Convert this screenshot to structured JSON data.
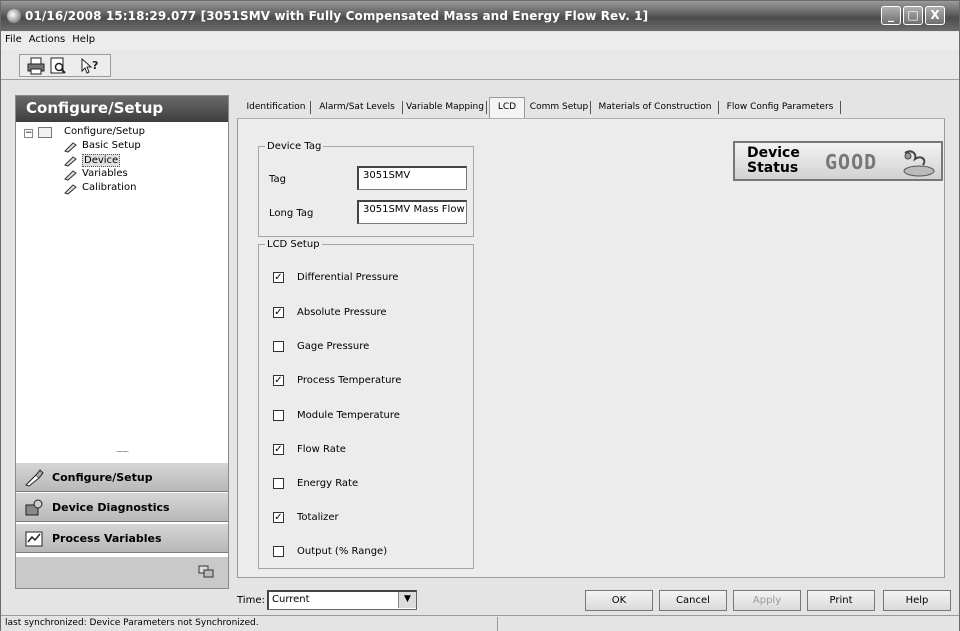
{
  "window": {
    "title": "01/16/2008 15:18:29.077 [3051SMV with Fully Compensated Mass and Energy Flow Rev. 1]",
    "minimize": "_",
    "maximize": "□",
    "close": "X"
  },
  "menu": [
    "File",
    "Actions",
    "Help"
  ],
  "toolbar": {
    "buttons": [
      "print-icon",
      "print-preview-icon",
      "help-pointer-icon"
    ]
  },
  "sidebar": {
    "header": "Configure/Setup",
    "tree": {
      "root": "Configure/Setup",
      "children": [
        "Basic Setup",
        "Device",
        "Variables",
        "Calibration"
      ],
      "selected": "Device"
    },
    "grip": "..........",
    "nav": [
      "Configure/Setup",
      "Device Diagnostics",
      "Process Variables"
    ]
  },
  "tabs": [
    "Identification",
    "Alarm/Sat Levels",
    "Variable Mapping",
    "LCD",
    "Comm Setup",
    "Materials of Construction",
    "Flow Config Parameters"
  ],
  "active_tab": "LCD",
  "device_tag": {
    "legend": "Device Tag",
    "tag_label": "Tag",
    "tag_value": "3051SMV",
    "long_tag_label": "Long Tag",
    "long_tag_value": "3051SMV Mass Flow"
  },
  "lcd_setup": {
    "legend": "LCD Setup",
    "items": [
      {
        "label": "Differential Pressure",
        "checked": true
      },
      {
        "label": "Absolute Pressure",
        "checked": true
      },
      {
        "label": "Gage Pressure",
        "checked": false
      },
      {
        "label": "Process Temperature",
        "checked": true
      },
      {
        "label": "Module Temperature",
        "checked": false
      },
      {
        "label": "Flow Rate",
        "checked": true
      },
      {
        "label": "Energy Rate",
        "checked": false
      },
      {
        "label": "Totalizer",
        "checked": true
      },
      {
        "label": "Output (% Range)",
        "checked": false
      }
    ],
    "check_mark": "✓"
  },
  "device_status": {
    "label_line1": "Device",
    "label_line2": "Status",
    "value": "GOOD"
  },
  "bottom": {
    "time_label": "Time:",
    "time_value": "Current",
    "dropdown_arrow": "▼",
    "buttons": [
      "OK",
      "Cancel",
      "Apply",
      "Print",
      "Help"
    ],
    "disabled_buttons": [
      "Apply"
    ]
  },
  "status_bar": "last synchronized: Device Parameters not Synchronized."
}
